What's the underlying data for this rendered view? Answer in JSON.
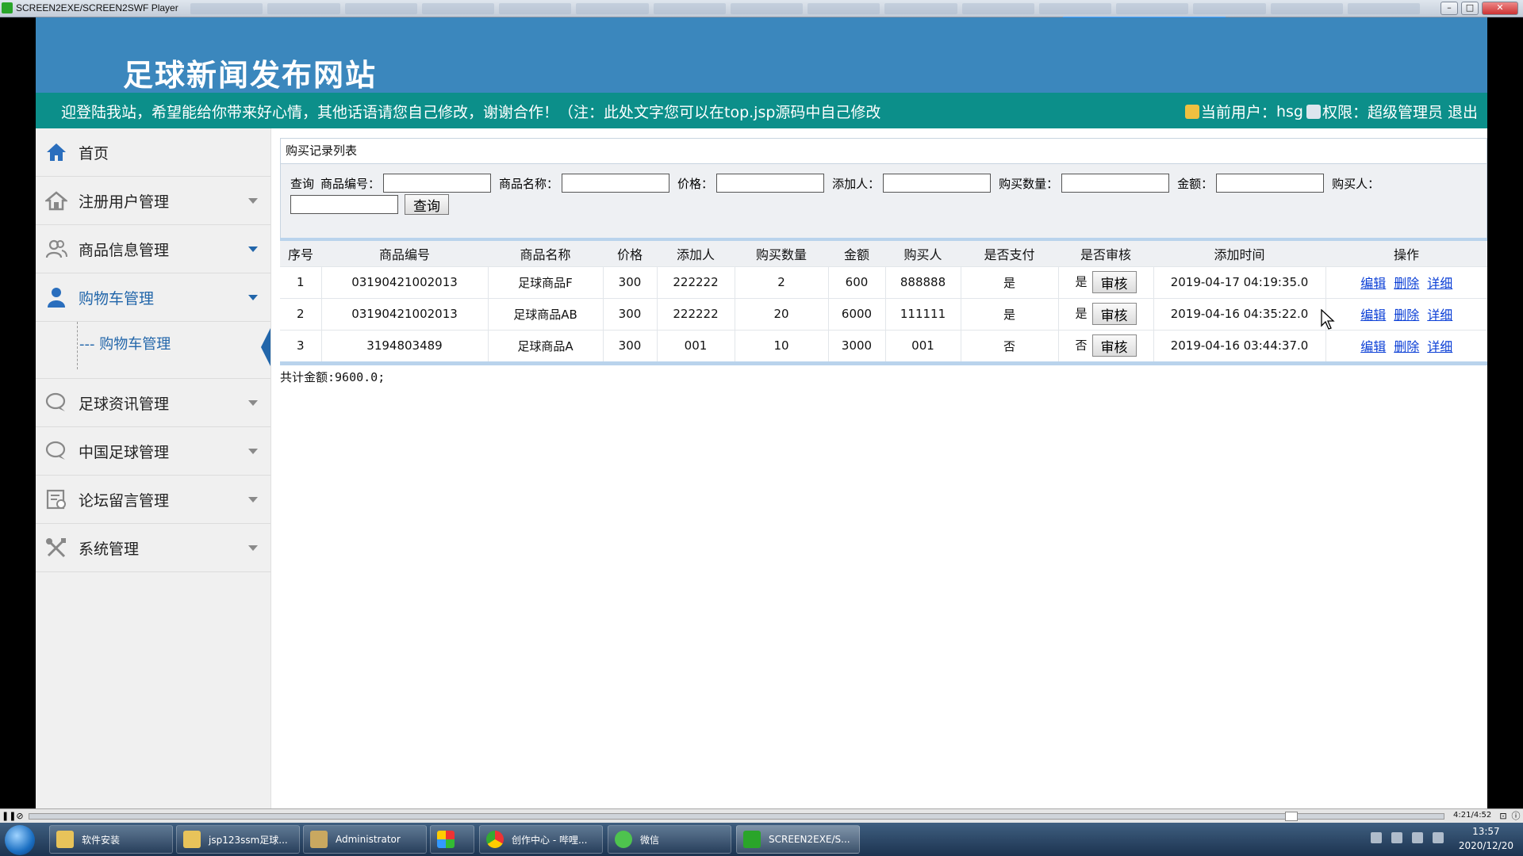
{
  "window": {
    "title": "SCREEN2EXE/SCREEN2SWF Player"
  },
  "site": {
    "title": "足球新闻发布网站",
    "welcome": "迎登陆我站，希望能给你带来好心情，其他话语请您自己修改，谢谢合作！（注：此处文字您可以在top.jsp源码中自己修改",
    "user_label": "当前用户：",
    "user_name": "hsg",
    "role_label": "权限：",
    "role_name": "超级管理员",
    "logout": "退出"
  },
  "sidebar": {
    "home": "首页",
    "items": [
      {
        "label": "注册用户管理",
        "icon": "home-outline-icon"
      },
      {
        "label": "商品信息管理",
        "icon": "users-icon"
      },
      {
        "label": "购物车管理",
        "icon": "user-icon"
      },
      {
        "label": "足球资讯管理",
        "icon": "chat-icon"
      },
      {
        "label": "中国足球管理",
        "icon": "chat-icon"
      },
      {
        "label": "论坛留言管理",
        "icon": "notes-icon"
      },
      {
        "label": "系统管理",
        "icon": "tools-icon"
      }
    ],
    "submenu": {
      "label": "购物车管理"
    }
  },
  "content": {
    "panel_title": "购买记录列表",
    "search": {
      "prefix": "查询",
      "fields": [
        {
          "label": "商品编号："
        },
        {
          "label": "商品名称："
        },
        {
          "label": "价格："
        },
        {
          "label": "添加人："
        },
        {
          "label": "购买数量："
        },
        {
          "label": "金额："
        },
        {
          "label": "购买人："
        }
      ],
      "button": "查询"
    },
    "table": {
      "headers": [
        "序号",
        "商品编号",
        "商品名称",
        "价格",
        "添加人",
        "购买数量",
        "金额",
        "购买人",
        "是否支付",
        "是否审核",
        "添加时间",
        "操作"
      ],
      "rows": [
        {
          "no": "1",
          "code": "03190421002013",
          "name": "足球商品F",
          "price": "300",
          "adder": "222222",
          "qty": "2",
          "amount": "600",
          "buyer": "888888",
          "paid": "是",
          "audited": "是",
          "time": "2019-04-17 04:19:35.0"
        },
        {
          "no": "2",
          "code": "03190421002013",
          "name": "足球商品AB",
          "price": "300",
          "adder": "222222",
          "qty": "20",
          "amount": "6000",
          "buyer": "111111",
          "paid": "是",
          "audited": "是",
          "time": "2019-04-16 04:35:22.0"
        },
        {
          "no": "3",
          "code": "3194803489",
          "name": "足球商品A",
          "price": "300",
          "adder": "001",
          "qty": "10",
          "amount": "3000",
          "buyer": "001",
          "paid": "否",
          "audited": "否",
          "time": "2019-04-16 03:44:37.0"
        }
      ],
      "audit_button": "审核",
      "ops": [
        "编辑",
        "删除",
        "详细"
      ]
    },
    "total": "共计金额:9600.0;"
  },
  "player": {
    "time": "4:21/4:52"
  },
  "taskbar": {
    "tasks": [
      {
        "label": "软件安装"
      },
      {
        "label": "jsp123ssm足球..."
      },
      {
        "label": "Administrator"
      },
      {
        "label": ""
      },
      {
        "label": "创作中心 - 哔哩..."
      },
      {
        "label": "微信"
      },
      {
        "label": "SCREEN2EXE/S..."
      }
    ],
    "clock_time": "13:57",
    "clock_date": "2020/12/20"
  },
  "colors": {
    "header": "#3b87bd",
    "marquee": "#0c8f8a",
    "accent": "#2266aa",
    "link": "#0b3fd6"
  }
}
